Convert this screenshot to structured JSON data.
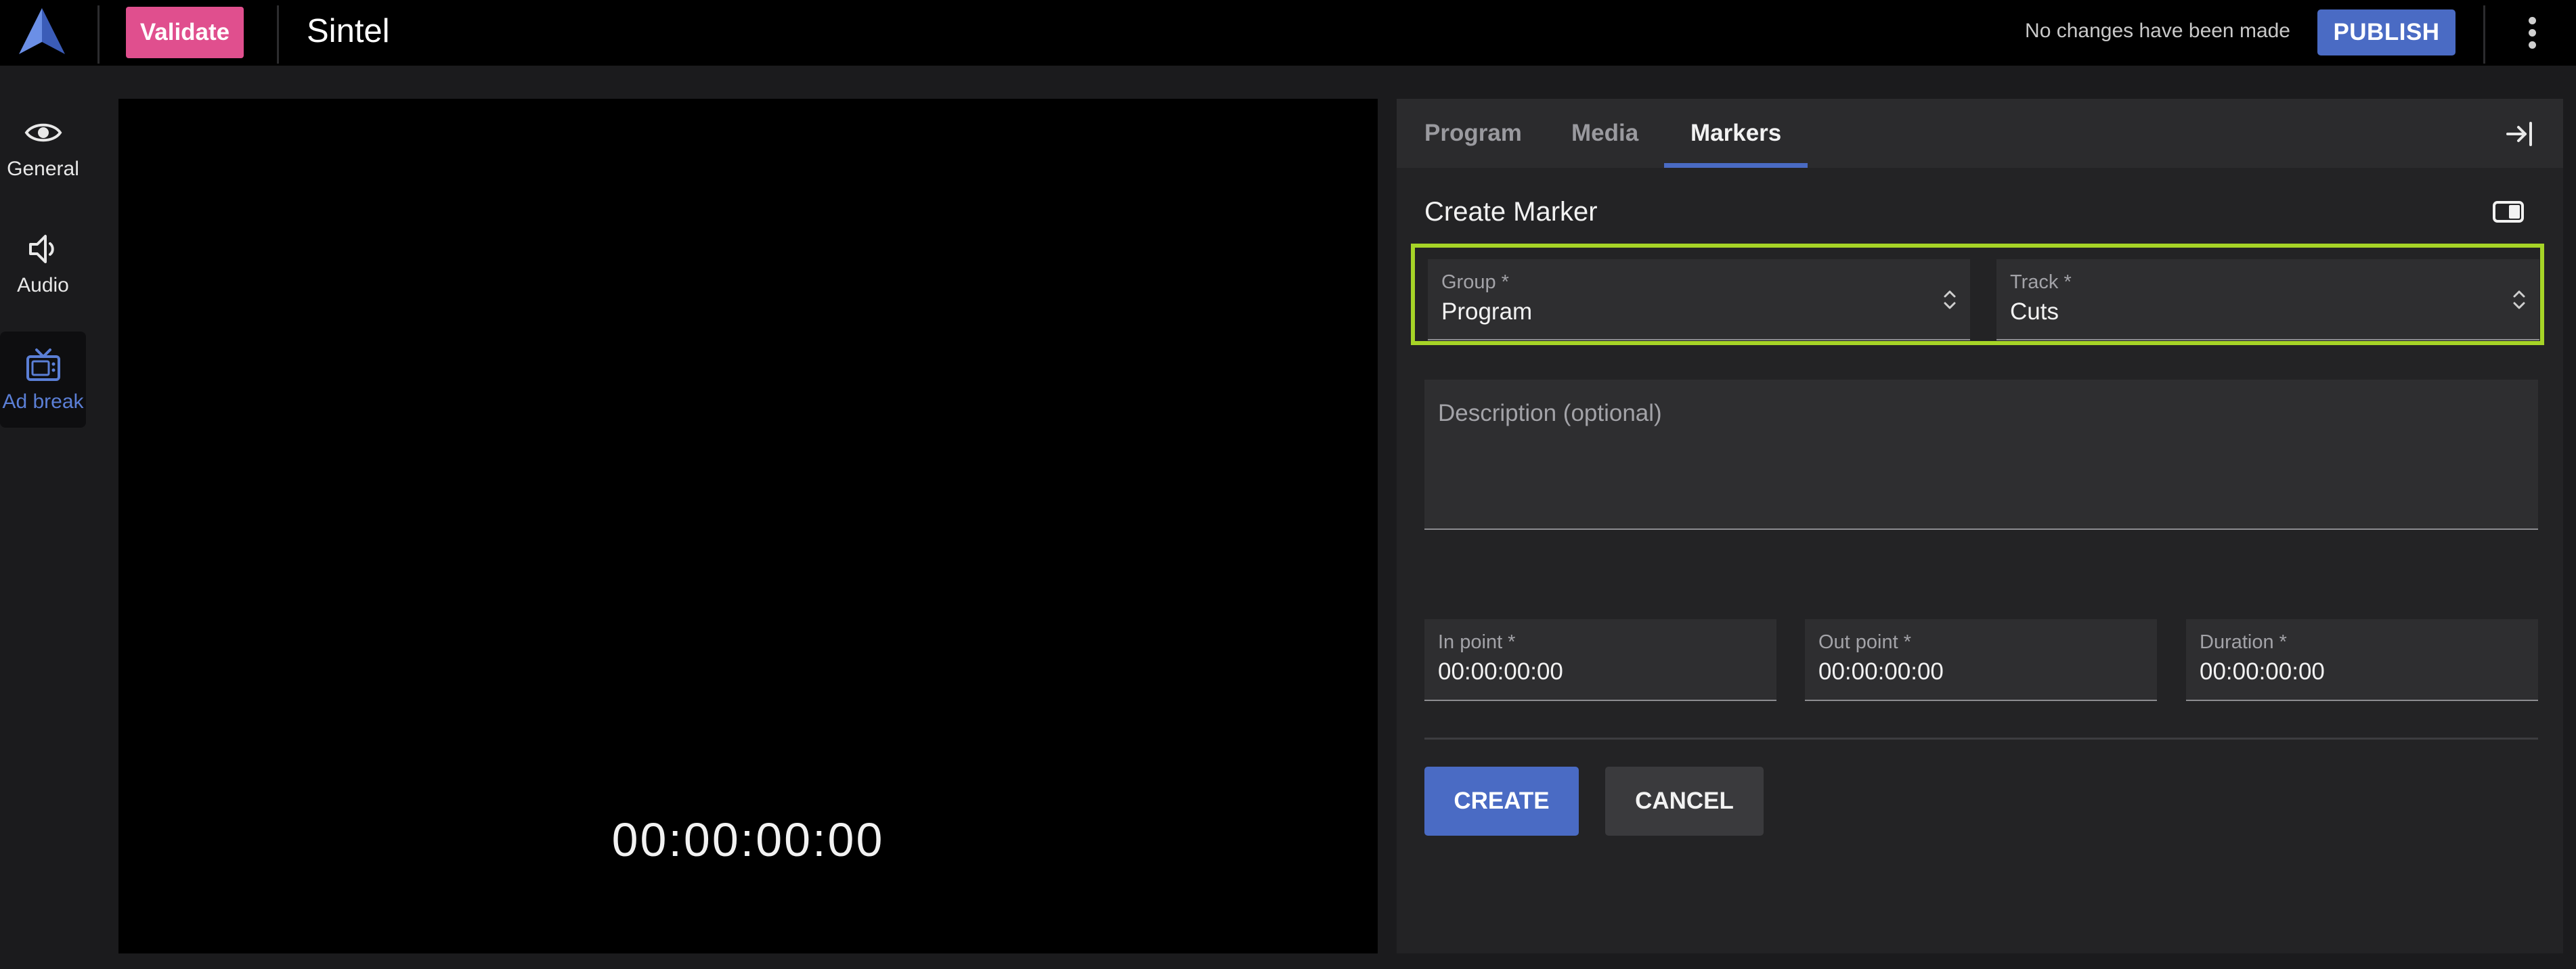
{
  "header": {
    "validate_label": "Validate",
    "title": "Sintel",
    "status": "No changes have been made",
    "publish_label": "PUBLISH"
  },
  "rail": {
    "items": [
      {
        "label": "General",
        "icon": "eye-icon"
      },
      {
        "label": "Audio",
        "icon": "speaker-icon"
      },
      {
        "label": "Ad break",
        "icon": "tv-icon",
        "active": true
      }
    ]
  },
  "player": {
    "timecode": "00:00:00:00"
  },
  "panel": {
    "tabs": [
      {
        "label": "Program"
      },
      {
        "label": "Media"
      },
      {
        "label": "Markers",
        "active": true
      }
    ],
    "section_title": "Create Marker",
    "group": {
      "label": "Group *",
      "value": "Program"
    },
    "track": {
      "label": "Track *",
      "value": "Cuts"
    },
    "description_placeholder": "Description (optional)",
    "in_point": {
      "label": "In point *",
      "value": "00:00:00:00"
    },
    "out_point": {
      "label": "Out point *",
      "value": "00:00:00:00"
    },
    "duration": {
      "label": "Duration *",
      "value": "00:00:00:00"
    },
    "create_label": "CREATE",
    "cancel_label": "CANCEL"
  },
  "colors": {
    "accent": "#4a6bc4",
    "validate": "#e04f8e",
    "highlight": "#a6d427",
    "rail_active": "#5b7fd6"
  }
}
